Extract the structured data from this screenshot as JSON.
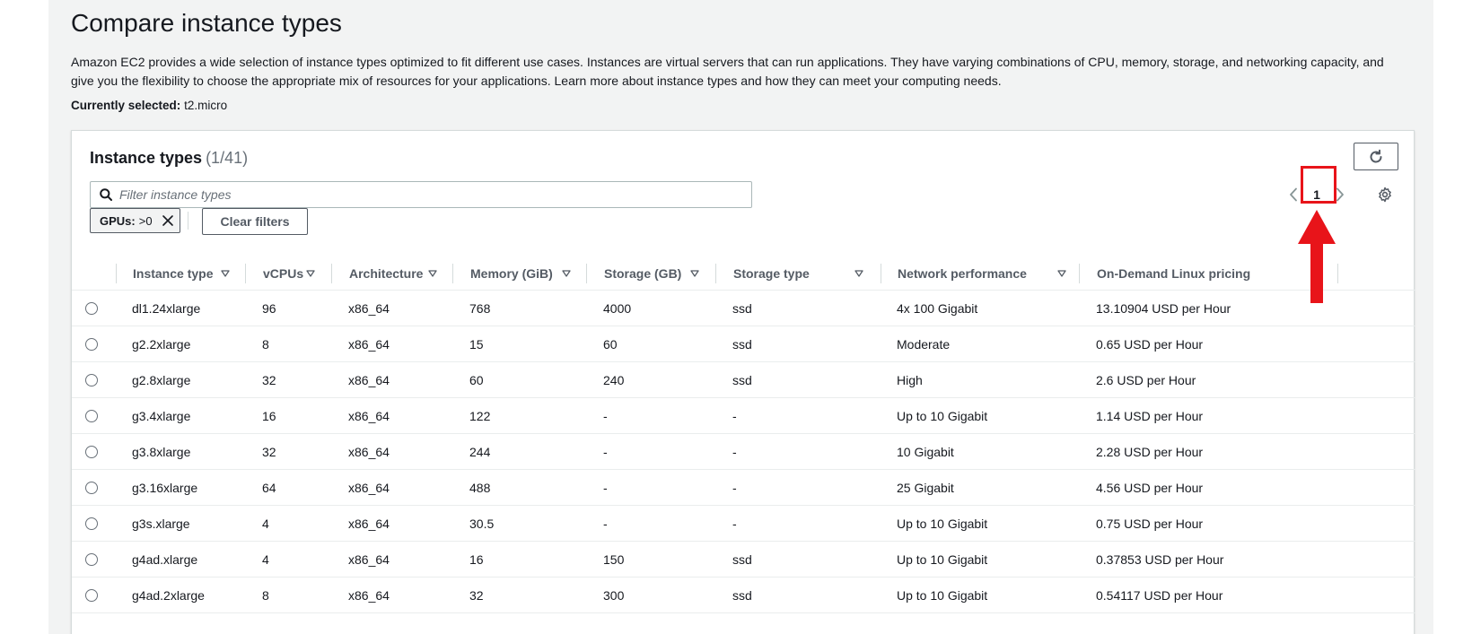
{
  "page": {
    "title": "Compare instance types",
    "description": "Amazon EC2 provides a wide selection of instance types optimized to fit different use cases. Instances are virtual servers that can run applications. They have varying combinations of CPU, memory, storage, and networking capacity, and give you the flexibility to choose the appropriate mix of resources for your applications. Learn more about instance types and how they can meet your computing needs.",
    "selected_label": "Currently selected:",
    "selected_value": "t2.micro"
  },
  "panel": {
    "heading": "Instance types",
    "count": "(1/41)",
    "search_placeholder": "Filter instance types",
    "page_number": "1",
    "filter_token_label": "GPUs:",
    "filter_token_value": ">0",
    "clear_filters": "Clear filters"
  },
  "table": {
    "columns": [
      "Instance type",
      "vCPUs",
      "Architecture",
      "Memory (GiB)",
      "Storage (GB)",
      "Storage type",
      "Network performance",
      "On-Demand Linux pricing"
    ],
    "rows": [
      [
        "dl1.24xlarge",
        "96",
        "x86_64",
        "768",
        "4000",
        "ssd",
        "4x 100 Gigabit",
        "13.10904 USD per Hour"
      ],
      [
        "g2.2xlarge",
        "8",
        "x86_64",
        "15",
        "60",
        "ssd",
        "Moderate",
        "0.65 USD per Hour"
      ],
      [
        "g2.8xlarge",
        "32",
        "x86_64",
        "60",
        "240",
        "ssd",
        "High",
        "2.6 USD per Hour"
      ],
      [
        "g3.4xlarge",
        "16",
        "x86_64",
        "122",
        "-",
        "-",
        "Up to 10 Gigabit",
        "1.14 USD per Hour"
      ],
      [
        "g3.8xlarge",
        "32",
        "x86_64",
        "244",
        "-",
        "-",
        "10 Gigabit",
        "2.28 USD per Hour"
      ],
      [
        "g3.16xlarge",
        "64",
        "x86_64",
        "488",
        "-",
        "-",
        "25 Gigabit",
        "4.56 USD per Hour"
      ],
      [
        "g3s.xlarge",
        "4",
        "x86_64",
        "30.5",
        "-",
        "-",
        "Up to 10 Gigabit",
        "0.75 USD per Hour"
      ],
      [
        "g4ad.xlarge",
        "4",
        "x86_64",
        "16",
        "150",
        "ssd",
        "Up to 10 Gigabit",
        "0.37853 USD per Hour"
      ],
      [
        "g4ad.2xlarge",
        "8",
        "x86_64",
        "32",
        "300",
        "ssd",
        "Up to 10 Gigabit",
        "0.54117 USD per Hour"
      ]
    ]
  },
  "icons": {
    "search": "search-icon",
    "refresh": "refresh-icon",
    "settings": "gear-icon",
    "prev": "chevron-left-icon",
    "next": "chevron-right-icon",
    "close": "close-icon",
    "sort": "caret-down-icon"
  },
  "colors": {
    "highlight": "#e8141a",
    "page_bg": "#f2f3f3"
  }
}
